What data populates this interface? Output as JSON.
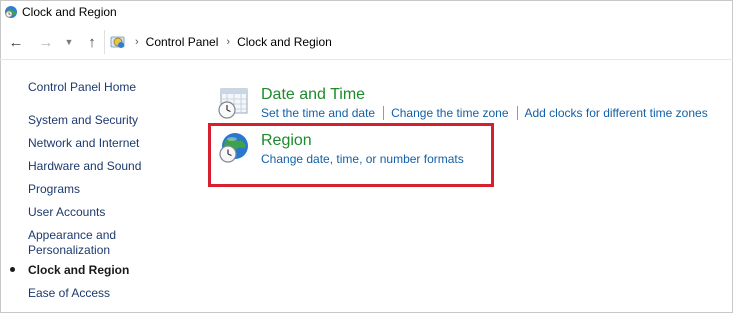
{
  "window": {
    "title": "Clock and Region"
  },
  "address_bar": {
    "breadcrumbs": [
      "Control Panel",
      "Clock and Region"
    ]
  },
  "sidebar": {
    "home": "Control Panel Home",
    "items": [
      {
        "label": "System and Security"
      },
      {
        "label": "Network and Internet"
      },
      {
        "label": "Hardware and Sound"
      },
      {
        "label": "Programs"
      },
      {
        "label": "User Accounts"
      },
      {
        "label": "Appearance and Personalization"
      },
      {
        "label": "Clock and Region",
        "current": true
      },
      {
        "label": "Ease of Access"
      }
    ]
  },
  "main": {
    "date_time": {
      "title": "Date and Time",
      "links": [
        "Set the time and date",
        "Change the time zone",
        "Add clocks for different time zones"
      ]
    },
    "region": {
      "title": "Region",
      "links": [
        "Change date, time, or number formats"
      ]
    }
  },
  "colors": {
    "category_title": "#1e8a2b",
    "link": "#1360a8",
    "highlight_border": "#d6202e"
  }
}
